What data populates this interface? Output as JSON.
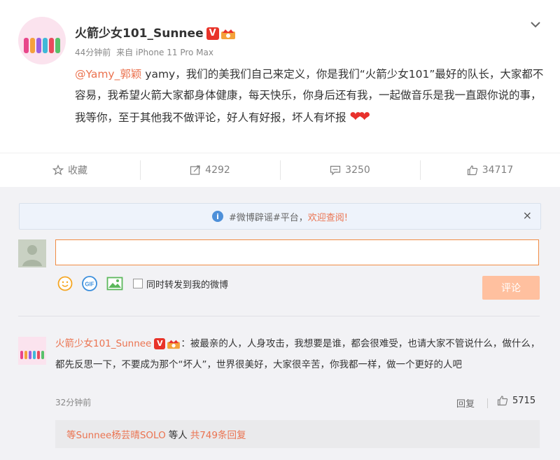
{
  "post": {
    "username": "火箭少女101_Sunnee",
    "verified_badge": "V",
    "time": "44分钟前",
    "source": "来自 iPhone 11 Pro Max",
    "mention": "@Yamy_郭颖",
    "text": " yamy，我们的美我们自己来定义，你是我们“火箭少女101”最好的队长，大家都不容易，我希望火箭大家都身体健康，每天快乐，你身后还有我，一起做音乐是我一直跟你说的事，我等你，至于其他我不做评论，好人有好报，坏人有坏报",
    "hearts": "❤❤",
    "icons": {
      "menu": "chevron-down-icon",
      "crown": "crown-badge-icon"
    }
  },
  "actions": {
    "favorite_label": "收藏",
    "repost_count": "4292",
    "comment_count": "3250",
    "like_count": "34717"
  },
  "notice": {
    "text_prefix": "#微博辟谣#平台，",
    "link": "欢迎查阅!",
    "close": "×"
  },
  "composer": {
    "input_value": "",
    "checkbox_label": "同时转发到我的微博",
    "submit_label": "评论",
    "gif_label": "GIF"
  },
  "comment": {
    "name": "火箭少女101_Sunnee",
    "verified_badge": "V",
    "text": "：被最亲的人，人身攻击，我想要是谁，都会很难受，也请大家不管说什么，做什么，都先反思一下，不要成为那个“坏人”，世界很美好，大家很辛苦，你我都一样，做一个更好的人吧",
    "time": "32分钟前",
    "reply_label": "回复",
    "like_count": "5715"
  },
  "replies": {
    "prefix": "等Sunnee杨芸晴SOLO",
    "middle": "等人",
    "total": "共749条回复"
  },
  "colors": {
    "accent": "#eb7350",
    "badge": "#e83329",
    "notice_bg": "#eef3fb",
    "submit_bg": "#ffc09f"
  }
}
